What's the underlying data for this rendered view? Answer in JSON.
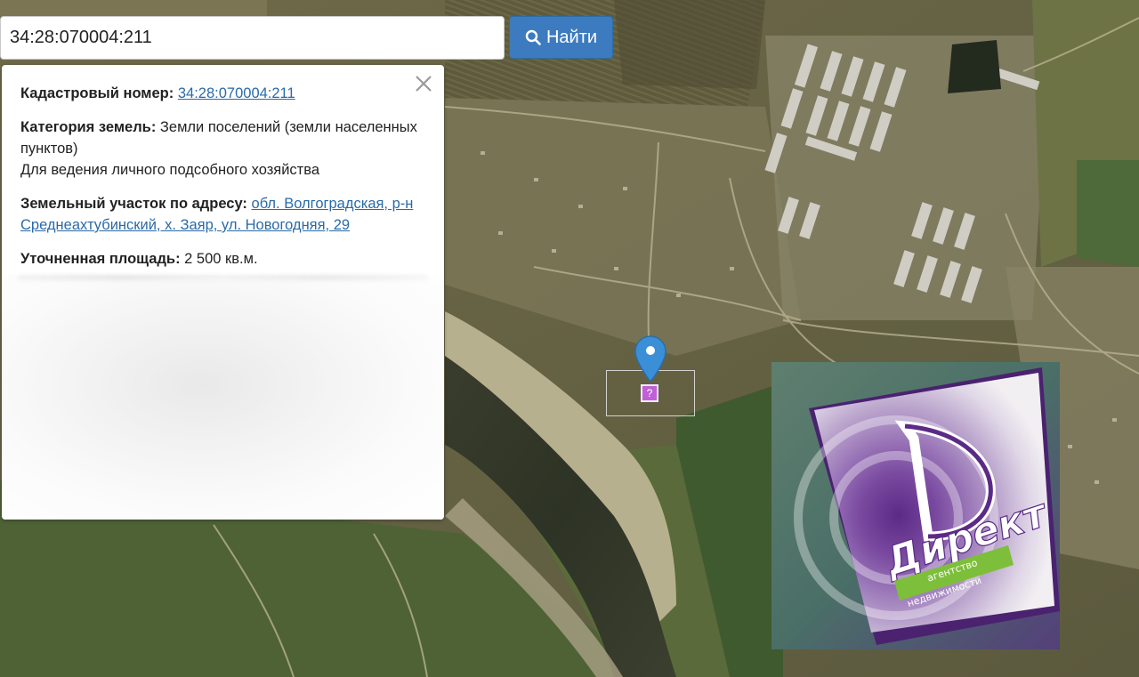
{
  "search": {
    "value": "34:28:070004:211",
    "button_label": "Найти",
    "button_icon": "search-icon"
  },
  "popup": {
    "cadastral_label": "Кадастровый номер:",
    "cadastral_value": "34:28:070004:211",
    "category_label": "Категория земель:",
    "category_value": "Земли поселений (земли населенных пунктов)",
    "use_value": "Для ведения личного подсобного хозяйства",
    "address_label": "Земельный участок по адресу:",
    "address_value": "обл. Волгоградская, р-н Среднеахтубинский, х. Заяр, ул. Новогодняя, 29",
    "area_label": "Уточненная площадь:",
    "area_value": "2 500 кв.м.",
    "close_icon": "close-icon"
  },
  "map": {
    "marker_icon": "map-pin-icon",
    "parcel_icon_text": "?"
  },
  "logo": {
    "word": "Директ",
    "subtitle_line1": "агентство",
    "subtitle_line2": "недвижимости"
  },
  "colors": {
    "button": "#3c7bbf",
    "link": "#2a6aa8",
    "marker": "#3b8fd6",
    "parcel_icon": "#c05fd6",
    "logo_purple": "#5b2a86",
    "logo_green": "#7dbf3a"
  }
}
